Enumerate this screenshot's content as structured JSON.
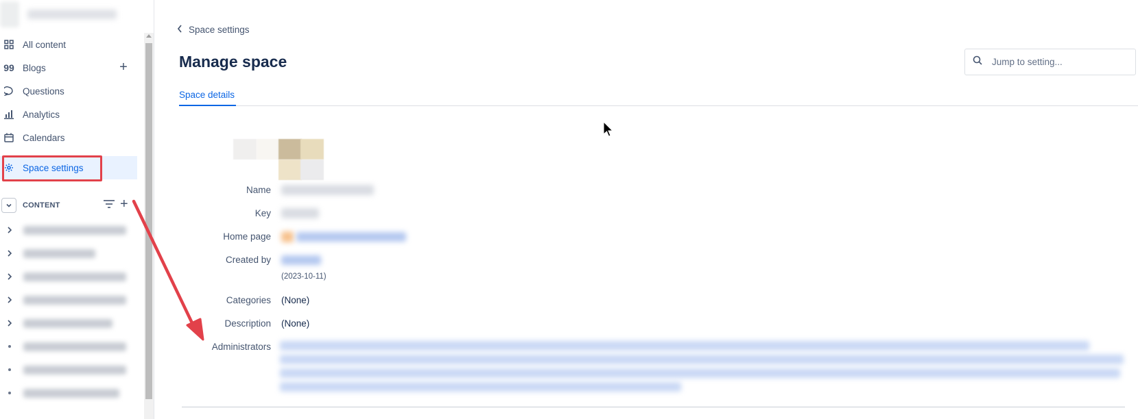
{
  "sidebar": {
    "items": [
      {
        "label": "All content",
        "icon": "grid-icon"
      },
      {
        "label": "Blogs",
        "icon": "quote-icon"
      },
      {
        "label": "Questions",
        "icon": "chat-bubble-icon"
      },
      {
        "label": "Analytics",
        "icon": "bar-chart-icon"
      },
      {
        "label": "Calendars",
        "icon": "calendar-icon"
      },
      {
        "label": "Space settings",
        "icon": "gear-icon",
        "active": true
      }
    ],
    "content_label": "CONTENT"
  },
  "breadcrumb": {
    "label": "Space settings"
  },
  "page": {
    "title": "Manage space"
  },
  "search": {
    "placeholder": "Jump to setting..."
  },
  "tabs": [
    {
      "label": "Space details",
      "active": true
    }
  ],
  "details": {
    "name_label": "Name",
    "key_label": "Key",
    "home_page_label": "Home page",
    "created_by_label": "Created by",
    "created_date": "(2023-10-11)",
    "categories_label": "Categories",
    "categories_value": "(None)",
    "description_label": "Description",
    "description_value": "(None)",
    "administrators_label": "Administrators"
  },
  "colors": {
    "accent": "#0c66e4",
    "active_bg": "#e9f2ff",
    "annotation_red": "#e2414a"
  }
}
